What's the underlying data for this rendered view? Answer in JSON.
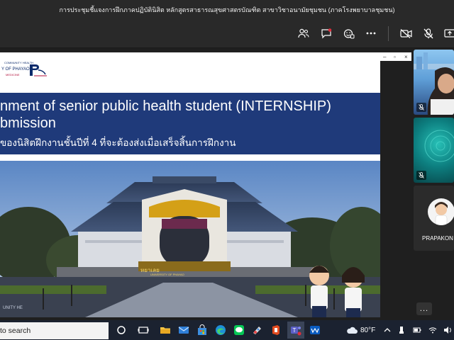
{
  "window": {
    "title": "การประชุมชี้แจงการฝึกภาคปฏิบัตินิสิต หลักสูตรสาธารณสุขศาสตรบัณฑิต สาขาวิชาอนามัยชุมชน (ภาคโรงพยาบาลชุมชน)"
  },
  "toolbar": {
    "icons": [
      "people-icon",
      "chat-icon",
      "reactions-icon",
      "more-icon",
      "camera-off-icon",
      "mic-off-icon",
      "share-icon"
    ]
  },
  "slide": {
    "logo_line1": "COMMUNITY HEALTH",
    "logo_line2": "Y OF PHAYAO",
    "logo_line3": "MEDICINE",
    "title_line1": "nment of senior public health student (INTERNSHIP)",
    "title_line2": "bmission",
    "subtitle": "ของนิสิตฝึกงานชั้นปีที่ 4 ที่จะต้องส่งเมื่อเสร็จสิ้นการฝึกงาน",
    "building_sign": "หยาเลย",
    "building_sign2": "UNIVERSITY OF PHAYAO",
    "watermark": "UNITY HE"
  },
  "participants": [
    {
      "name": "",
      "muted": true
    },
    {
      "name": "",
      "muted": true
    },
    {
      "name": "PRAPAKON ...",
      "muted": false
    }
  ],
  "more_label": "...",
  "taskbar": {
    "search_text": "to search",
    "weather": "80°F"
  },
  "colors": {
    "banner": "#1f3a7a",
    "taskbar": "#1b2230",
    "toolbar": "#292929"
  }
}
